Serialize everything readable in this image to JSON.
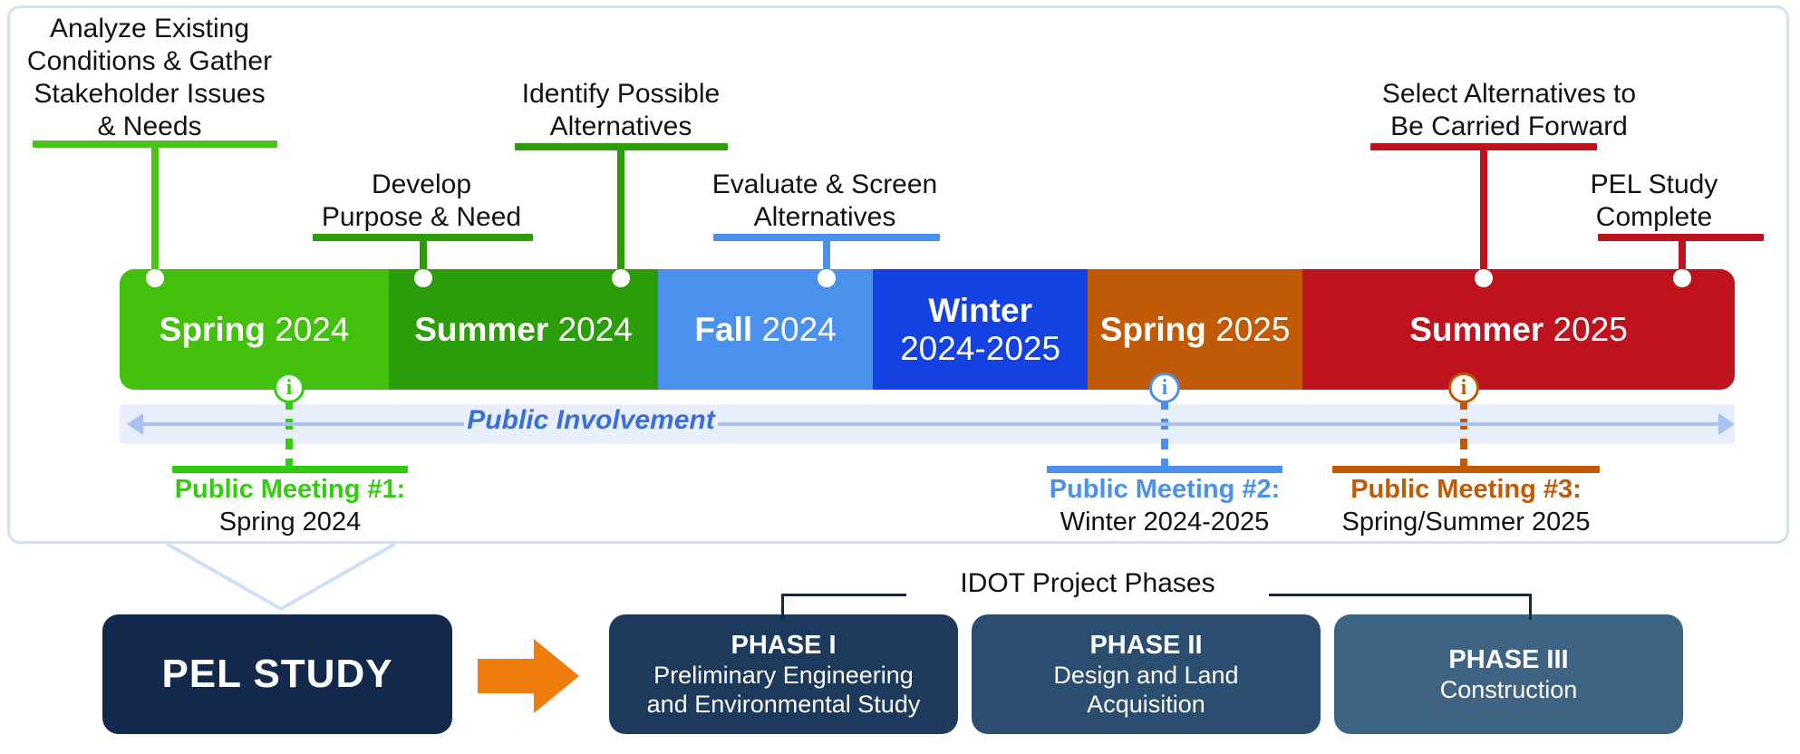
{
  "colors": {
    "spring_2024": "#4CC417",
    "spring_2024_exact": "#43c00b",
    "summer_2024": "#2a9d08",
    "fall_2024": "#4a90ec",
    "winter_2024_2025": "#1342e0",
    "spring_2025": "#c05a06",
    "summer_2025": "#bf121f",
    "public_involvement_strip": "#e8eefc",
    "public_involvement_text": "#3a6fd8",
    "pel_navy": "#13294b",
    "phase1": "#1d3a5c",
    "phase2": "#2b4d6f",
    "phase3": "#3f6483",
    "orange_arrow": "#ef7d0e",
    "panel_border": "#cfe0f7"
  },
  "milestones": [
    {
      "id": "analyze-existing-conditions",
      "label": "Analyze Existing\nConditions & Gather\nStakeholder Issues\n& Needs",
      "color": "#4CC417"
    },
    {
      "id": "develop-purpose-need",
      "label": "Develop\nPurpose & Need",
      "color": "#2a9d08"
    },
    {
      "id": "identify-possible-alternatives",
      "label": "Identify Possible\nAlternatives",
      "color": "#2a9d08"
    },
    {
      "id": "evaluate-screen-alternatives",
      "label": "Evaluate & Screen\nAlternatives",
      "color": "#4a90ec"
    },
    {
      "id": "select-alternatives-carried-forward",
      "label": "Select Alternatives to\nBe Carried Forward",
      "color": "#bf121f"
    },
    {
      "id": "pel-study-complete",
      "label": "PEL Study\nComplete",
      "color": "#bf121f"
    }
  ],
  "timeline": {
    "seasons": [
      {
        "id": "spring-2024",
        "name": "Spring",
        "year": "2024",
        "color": "#43c00b",
        "stacked": false
      },
      {
        "id": "summer-2024",
        "name": "Summer",
        "year": "2024",
        "color": "#2a9d08",
        "stacked": false
      },
      {
        "id": "fall-2024",
        "name": "Fall",
        "year": "2024",
        "color": "#4a90ec",
        "stacked": false
      },
      {
        "id": "winter-2024-2025",
        "name": "Winter",
        "year": "2024-2025",
        "color": "#1342e0",
        "stacked": true
      },
      {
        "id": "spring-2025",
        "name": "Spring",
        "year": "2025",
        "color": "#c05a06",
        "stacked": false
      },
      {
        "id": "summer-2025",
        "name": "Summer",
        "year": "2025",
        "color": "#bf121f",
        "stacked": false
      }
    ]
  },
  "public_involvement": {
    "label": "Public Involvement",
    "icon": "info-icon"
  },
  "meetings": [
    {
      "id": "public-meeting-1",
      "title": "Public Meeting #1:",
      "when": "Spring 2024",
      "color": "#33cc11"
    },
    {
      "id": "public-meeting-2",
      "title": "Public Meeting #2:",
      "when": "Winter 2024-2025",
      "color": "#4a90ec"
    },
    {
      "id": "public-meeting-3",
      "title": "Public Meeting #3:",
      "when": "Spring/Summer 2025",
      "color": "#c05a06"
    }
  ],
  "bottom": {
    "pel_study_label": "PEL STUDY",
    "bracket_label": "IDOT Project Phases",
    "phases": [
      {
        "id": "phase-1",
        "title": "PHASE I",
        "sub": "Preliminary Engineering\nand Environmental Study",
        "color": "#1d3a5c"
      },
      {
        "id": "phase-2",
        "title": "PHASE II",
        "sub": "Design and Land\nAcquisition",
        "color": "#2b4d6f"
      },
      {
        "id": "phase-3",
        "title": "PHASE III",
        "sub": "Construction",
        "color": "#3f6483"
      }
    ]
  },
  "chart_data": {
    "type": "table",
    "title": "PEL Study Project Timeline",
    "categories": [
      "Spring 2024",
      "Summer 2024",
      "Fall 2024",
      "Winter 2024-2025",
      "Spring 2025",
      "Summer 2025"
    ],
    "milestones": [
      {
        "period": "Spring 2024",
        "task": "Analyze Existing Conditions & Gather Stakeholder Issues & Needs"
      },
      {
        "period": "Summer 2024",
        "task": "Develop Purpose & Need"
      },
      {
        "period": "Summer 2024",
        "task": "Identify Possible Alternatives"
      },
      {
        "period": "Fall 2024",
        "task": "Evaluate & Screen Alternatives"
      },
      {
        "period": "Spring 2025",
        "task": "Select Alternatives to Be Carried Forward"
      },
      {
        "period": "Summer 2025",
        "task": "PEL Study Complete"
      }
    ],
    "public_meetings": [
      {
        "name": "Public Meeting #1",
        "when": "Spring 2024"
      },
      {
        "name": "Public Meeting #2",
        "when": "Winter 2024-2025"
      },
      {
        "name": "Public Meeting #3",
        "when": "Spring/Summer 2025"
      }
    ],
    "phases": [
      {
        "name": "PHASE I",
        "desc": "Preliminary Engineering and Environmental Study"
      },
      {
        "name": "PHASE II",
        "desc": "Design and Land Acquisition"
      },
      {
        "name": "PHASE III",
        "desc": "Construction"
      }
    ]
  }
}
